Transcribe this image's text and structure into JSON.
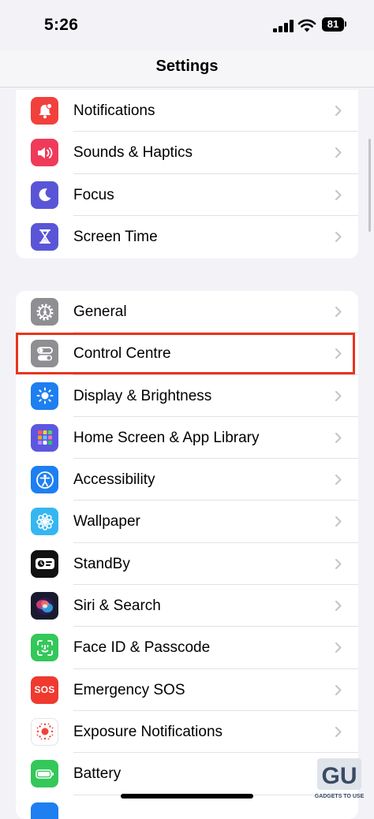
{
  "status_bar": {
    "time": "5:26",
    "battery_level": "81"
  },
  "nav": {
    "title": "Settings"
  },
  "group1": [
    {
      "label": "Notifications",
      "icon": "bell-badge-icon",
      "color": "#f2403c"
    },
    {
      "label": "Sounds & Haptics",
      "icon": "speaker-icon",
      "color": "#f03a5a"
    },
    {
      "label": "Focus",
      "icon": "moon-icon",
      "color": "#5a55d6"
    },
    {
      "label": "Screen Time",
      "icon": "hourglass-icon",
      "color": "#5a55d6"
    }
  ],
  "group2": [
    {
      "label": "General",
      "icon": "gear-icon",
      "color": "#8e8e93"
    },
    {
      "label": "Control Centre",
      "icon": "toggles-icon",
      "color": "#8e8e93"
    },
    {
      "label": "Display & Brightness",
      "icon": "sun-icon",
      "color": "#1e7ff0"
    },
    {
      "label": "Home Screen & App Library",
      "icon": "app-grid-icon",
      "color": "#5d56e0"
    },
    {
      "label": "Accessibility",
      "icon": "accessibility-icon",
      "color": "#1e7ff0"
    },
    {
      "label": "Wallpaper",
      "icon": "flower-icon",
      "color": "#36b6f0"
    },
    {
      "label": "StandBy",
      "icon": "standby-icon",
      "color": "#111111"
    },
    {
      "label": "Siri & Search",
      "icon": "siri-icon",
      "color": "#1a1a2e"
    },
    {
      "label": "Face ID & Passcode",
      "icon": "face-id-icon",
      "color": "#34c759"
    },
    {
      "label": "Emergency SOS",
      "icon": "sos-icon",
      "color": "#f0392f",
      "icon_text": "SOS"
    },
    {
      "label": "Exposure Notifications",
      "icon": "exposure-icon",
      "color": "#ffffff"
    },
    {
      "label": "Battery",
      "icon": "battery-icon",
      "color": "#34c759"
    }
  ],
  "highlighted_item": "Control Centre",
  "watermark_text": "GADGETS TO USE"
}
